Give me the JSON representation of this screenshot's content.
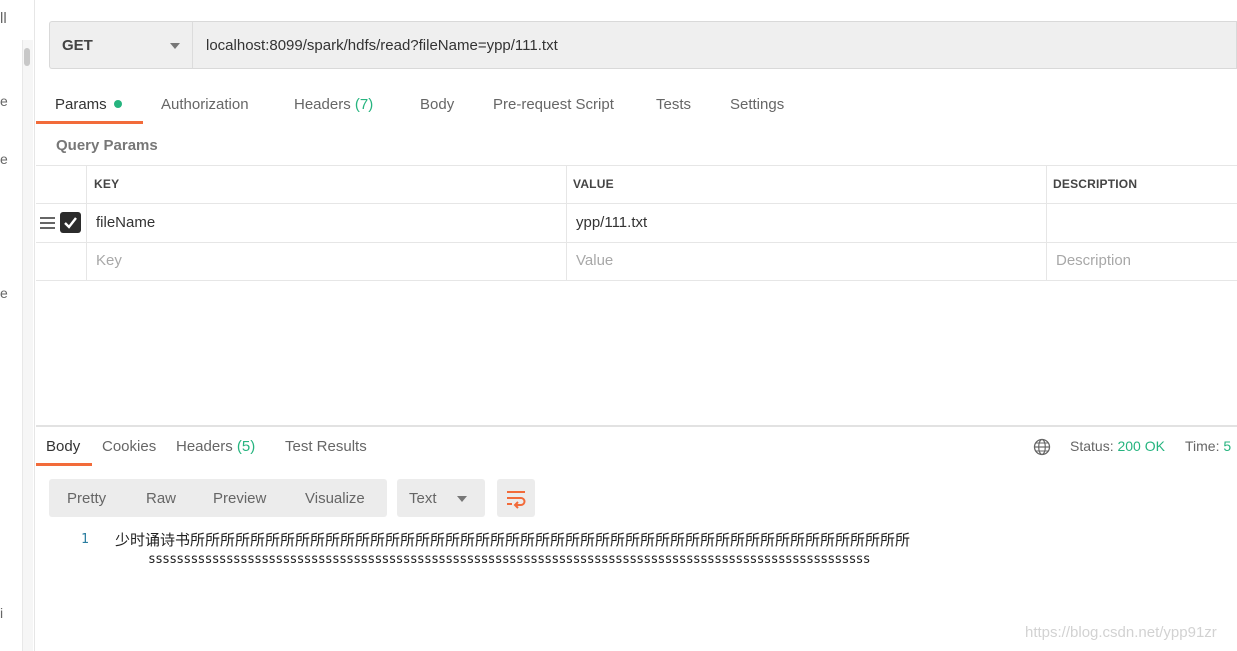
{
  "sidebar_fragments": [
    "ll",
    "e",
    "e",
    "e",
    "i"
  ],
  "request": {
    "method": "GET",
    "url": "localhost:8099/spark/hdfs/read?fileName=ypp/111.txt"
  },
  "request_tabs": {
    "params": "Params",
    "authorization": "Authorization",
    "headers": "Headers",
    "headers_count": "(7)",
    "body": "Body",
    "pre_request": "Pre-request Script",
    "tests": "Tests",
    "settings": "Settings"
  },
  "query_params": {
    "title": "Query Params",
    "columns": [
      "KEY",
      "VALUE",
      "DESCRIPTION"
    ],
    "rows": [
      {
        "key": "fileName",
        "value": "ypp/111.txt",
        "description": "",
        "checked": true
      }
    ],
    "placeholders": {
      "key": "Key",
      "value": "Value",
      "description": "Description"
    }
  },
  "response_tabs": {
    "body": "Body",
    "cookies": "Cookies",
    "headers": "Headers",
    "headers_count": "(5)",
    "test_results": "Test Results"
  },
  "status": {
    "label": "Status:",
    "value": "200 OK",
    "time_label": "Time:",
    "time_value": "5"
  },
  "view_modes": [
    "Pretty",
    "Raw",
    "Preview",
    "Visualize"
  ],
  "format_select": "Text",
  "response_body": {
    "line_number": "1",
    "line_text": "少时诵诗书所所所所所所所所所所所所所所所所所所所所所所所所所所所所所所所所所所所所所所所所所所所所所所所所",
    "wrapped_text": "ssssssssssssssssssssssssssssssssssssssssssssssssssssssssssssssssssssssssssssssssssssssssssssssssssssss"
  },
  "watermark": "https://blog.csdn.net/ypp91zr",
  "colors": {
    "accent": "#f26b3a",
    "success": "#26b47f"
  },
  "icons": [
    "drag-handle-icon",
    "checkbox-checked-icon",
    "chevron-down-icon",
    "globe-icon",
    "wrap-lines-icon"
  ]
}
